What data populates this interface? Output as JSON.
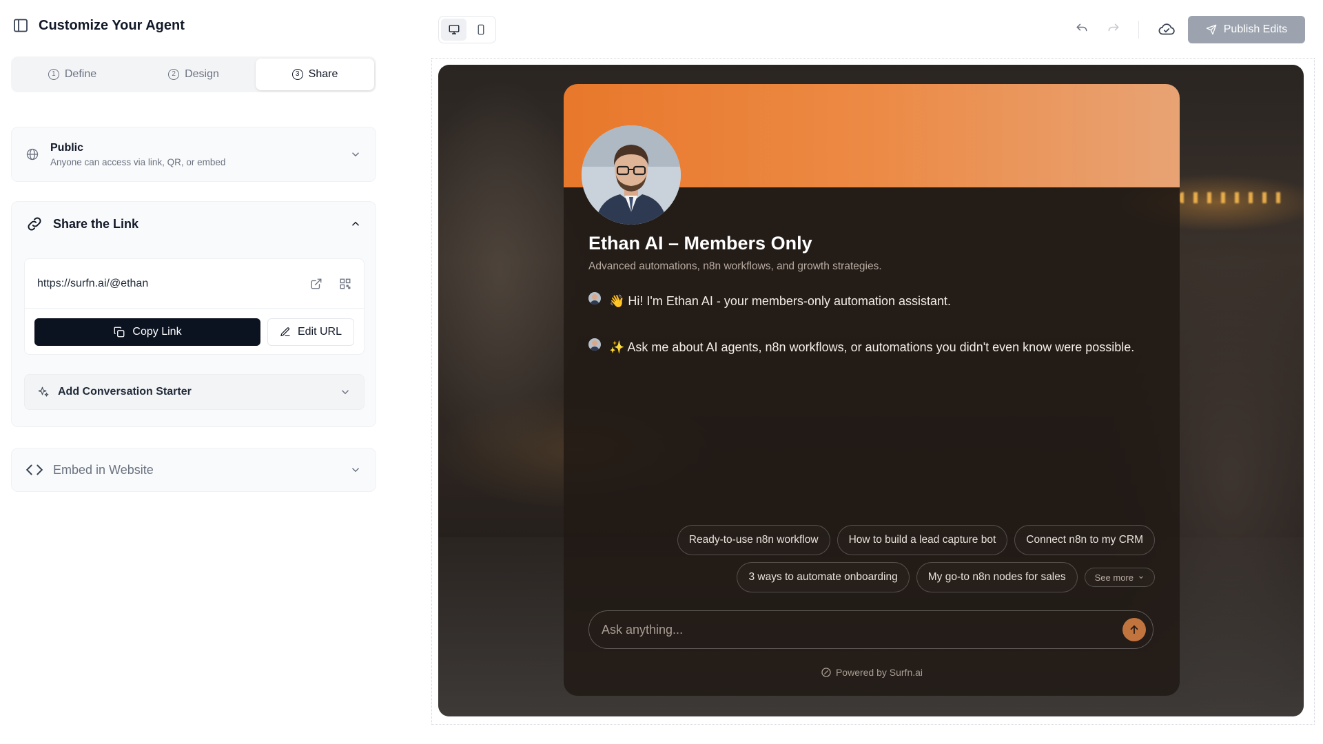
{
  "sidebar": {
    "title": "Customize Your Agent",
    "tabs": [
      {
        "num": "1",
        "label": "Define"
      },
      {
        "num": "2",
        "label": "Design"
      },
      {
        "num": "3",
        "label": "Share"
      }
    ],
    "active_tab": "Share",
    "visibility": {
      "title": "Public",
      "subtitle": "Anyone can access via link, QR, or embed"
    },
    "share_link": {
      "heading": "Share the Link",
      "url": "https://surfn.ai/@ethan",
      "copy_label": "Copy Link",
      "edit_label": "Edit URL"
    },
    "starter": {
      "label": "Add Conversation Starter"
    },
    "embed": {
      "label": "Embed in Website"
    }
  },
  "toolbar": {
    "publish_label": "Publish Edits",
    "active_device": "desktop"
  },
  "preview": {
    "name": "Ethan AI – Members Only",
    "subtitle": "Advanced automations, n8n workflows, and growth strategies.",
    "messages": [
      "👋 Hi! I'm Ethan AI - your members-only automation assistant.",
      "✨ Ask me about AI agents, n8n workflows, or automations you didn't even know were possible."
    ],
    "chips_row1": [
      "Ready-to-use n8n workflow",
      "How to build a lead capture bot",
      "Connect n8n to my CRM"
    ],
    "chips_row2": [
      "3 ways to automate onboarding",
      "My go-to n8n nodes for sales"
    ],
    "see_more": "See more",
    "input_placeholder": "Ask anything...",
    "powered_by": "Powered by Surfn.ai"
  },
  "colors": {
    "banner_start": "#e8782b",
    "banner_end": "#e8a374",
    "send_button": "#c2743f",
    "copy_button": "#0b1220",
    "publish_button": "#9ca3af"
  }
}
